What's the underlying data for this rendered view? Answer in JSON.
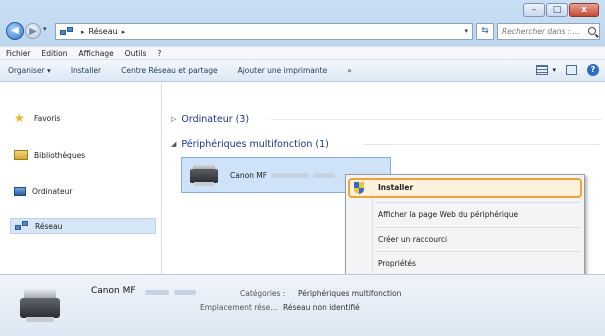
{
  "window": {
    "controls": {
      "minimize": "–",
      "maximize": "□",
      "close": "x"
    }
  },
  "address_bar": {
    "path_separator": "▸",
    "location": "Réseau",
    "trailing_separator": "▸",
    "refresh": "⇆"
  },
  "search": {
    "placeholder": "Rechercher dans : ..."
  },
  "menubar": {
    "items": [
      "Fichier",
      "Edition",
      "Affichage",
      "Outils",
      "?"
    ]
  },
  "toolbar": {
    "organize": "Organiser ▾",
    "install": "Installer",
    "network_center": "Centre Réseau et partage",
    "add_printer": "Ajouter une imprimante",
    "more": "»",
    "view_dropdown": "▾",
    "help": "?"
  },
  "sidebar": {
    "items": [
      {
        "label": "Favoris",
        "icon": "star-icon"
      },
      {
        "label": "Bibliothèques",
        "icon": "library-icon"
      },
      {
        "label": "Ordinateur",
        "icon": "computer-icon"
      },
      {
        "label": "Réseau",
        "icon": "network-icon",
        "selected": true
      }
    ]
  },
  "content": {
    "groups": [
      {
        "arrow": "▷",
        "label": "Ordinateur (3)"
      },
      {
        "arrow": "◢",
        "label": "Périphériques multifonction (1)"
      }
    ],
    "device": {
      "name": "Canon MF"
    }
  },
  "context_menu": {
    "items": [
      "Installer",
      "Afficher la page Web du périphérique",
      "Créer un raccourci",
      "Propriétés"
    ],
    "highlighted": "Installer",
    "highlight_color": "#f0a23b"
  },
  "details": {
    "name": "Canon MF",
    "category_label": "Catégories :",
    "category_value": "Périphériques multifonction",
    "location_label": "Emplacement rése...",
    "location_value": "Réseau non identifié"
  }
}
